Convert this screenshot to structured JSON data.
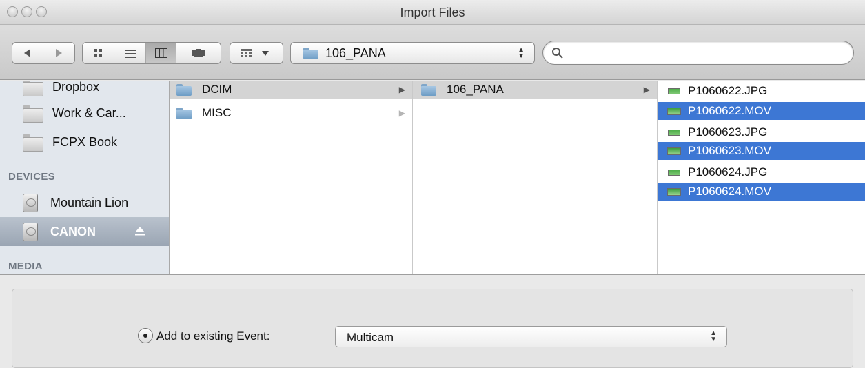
{
  "window": {
    "title": "Import Files"
  },
  "toolbar": {
    "location": "106_PANA",
    "search_placeholder": ""
  },
  "sidebar": {
    "favorites": [
      {
        "label": "Dropbox"
      },
      {
        "label": "Work & Car..."
      },
      {
        "label": "FCPX Book"
      }
    ],
    "devices_header": "DEVICES",
    "devices": [
      {
        "label": "Mountain Lion"
      },
      {
        "label": "CANON",
        "selected": true
      }
    ],
    "media_header": "MEDIA"
  },
  "columns": {
    "col1": [
      {
        "name": "DCIM",
        "highlighted": true
      },
      {
        "name": "MISC"
      }
    ],
    "col2": [
      {
        "name": "106_PANA",
        "highlighted": true
      }
    ],
    "col3": [
      {
        "name": "P1060622.JPG",
        "selected": false
      },
      {
        "name": "P1060622.MOV",
        "selected": true
      },
      {
        "name": "P1060623.JPG",
        "selected": false
      },
      {
        "name": "P1060623.MOV",
        "selected": true
      },
      {
        "name": "P1060624.JPG",
        "selected": false
      },
      {
        "name": "P1060624.MOV",
        "selected": true
      }
    ]
  },
  "import": {
    "option_label": "Add to existing Event:",
    "event_value": "Multicam"
  },
  "colors": {
    "selection": "#3d77d4",
    "sidebar_bg": "#e2e7ed"
  }
}
